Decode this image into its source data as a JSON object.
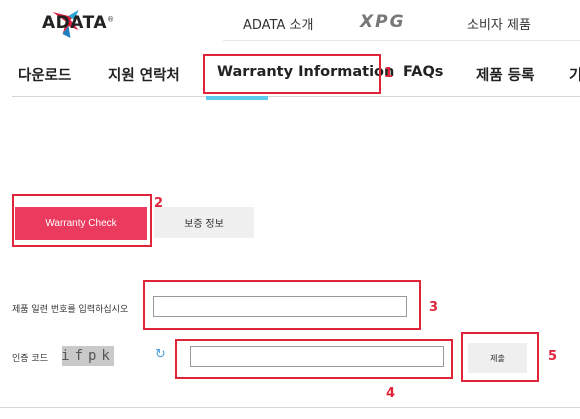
{
  "header": {
    "logo_text": "ADATA",
    "logo_mark": "®",
    "top_links": [
      "ADATA 소개",
      "XPG",
      "소비자 제품"
    ]
  },
  "nav": {
    "items": [
      "다운로드",
      "지원 연락처",
      "Warranty Information",
      "FAQs",
      "제품 등록",
      "기"
    ],
    "active_index": 2
  },
  "tabs": {
    "warranty_check": "Warranty Check",
    "warranty_info": "보증 정보"
  },
  "form": {
    "serial_label": "제품 일련 번호를 입력하십시오",
    "serial_value": "",
    "code_label": "인증 코드",
    "captcha_text": "ifpk",
    "code_value": "",
    "submit_label": "제출"
  },
  "annotations": [
    "1",
    "2",
    "3",
    "4",
    "5"
  ],
  "colors": {
    "accent": "#ea3a5d",
    "annotation": "#e0253a",
    "tab_underline": "#5fc8ee"
  }
}
